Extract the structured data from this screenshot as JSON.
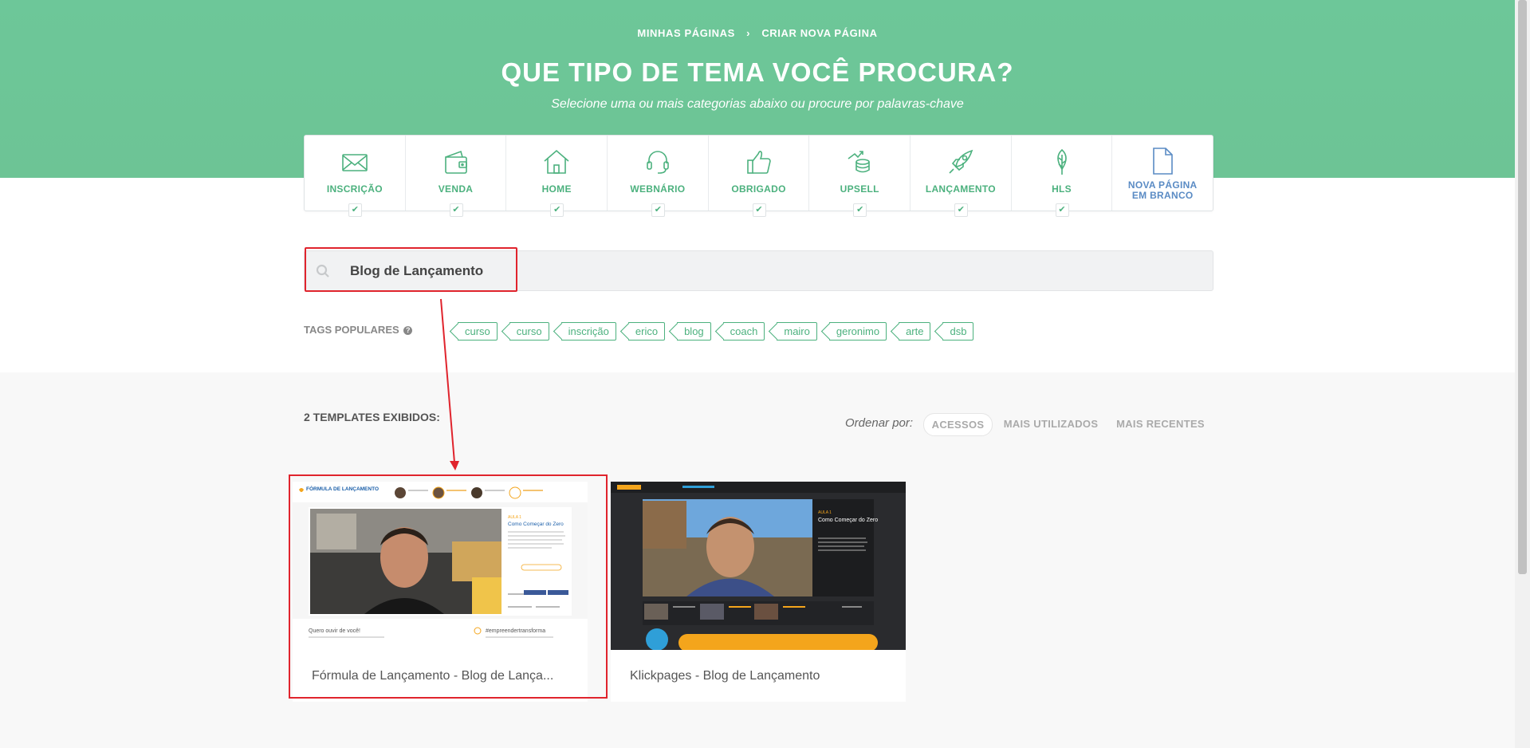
{
  "breadcrumb": {
    "parent": "MINHAS PÁGINAS",
    "separator": "›",
    "current": "CRIAR NOVA PÁGINA"
  },
  "hero": {
    "title": "QUE TIPO DE TEMA VOCÊ PROCURA?",
    "subtitle": "Selecione uma ou mais categorias abaixo ou procure por palavras-chave"
  },
  "categories": [
    {
      "label": "INSCRIÇÃO",
      "icon": "envelope-icon",
      "checked": true
    },
    {
      "label": "VENDA",
      "icon": "wallet-icon",
      "checked": true
    },
    {
      "label": "HOME",
      "icon": "house-icon",
      "checked": true
    },
    {
      "label": "WEBNÁRIO",
      "icon": "headset-icon",
      "checked": true
    },
    {
      "label": "OBRIGADO",
      "icon": "thumbs-up-icon",
      "checked": true
    },
    {
      "label": "UPSELL",
      "icon": "coins-icon",
      "checked": true
    },
    {
      "label": "LANÇAMENTO",
      "icon": "rocket-icon",
      "checked": true
    },
    {
      "label": "HLS",
      "icon": "leaf-icon",
      "checked": true
    }
  ],
  "blank_page": {
    "line1": "NOVA PÁGINA",
    "line2": "EM BRANCO",
    "icon": "document-icon"
  },
  "search": {
    "value": "Blog de Lançamento",
    "icon": "search-icon"
  },
  "tags": {
    "label": "TAGS POPULARES",
    "help": "?",
    "items": [
      "curso",
      "curso",
      "inscrição",
      "erico",
      "blog",
      "coach",
      "mairo",
      "geronimo",
      "arte",
      "dsb"
    ]
  },
  "results": {
    "count_label": "2 TEMPLATES EXIBIDOS:",
    "sort_label": "Ordenar por:",
    "sort_options": [
      "ACESSOS",
      "MAIS UTILIZADOS",
      "MAIS RECENTES"
    ],
    "active_sort": "ACESSOS"
  },
  "templates": [
    {
      "name": "Fórmula de Lançamento - Blog de Lança...",
      "preview": {
        "logo": "FÓRMULA DE LANÇAMENTO",
        "lesson": "AULA 1",
        "heading": "Como Começar do Zero",
        "comment": "Quero ouvir de você!",
        "hashtag": "#empreendertransforma"
      }
    },
    {
      "name": "Klickpages - Blog de Lançamento",
      "preview": {
        "lesson": "AULA 1",
        "heading": "Como Começar do Zero"
      }
    }
  ],
  "colors": {
    "brand_green": "#6dc799",
    "highlight_red": "#e0242d",
    "link_blue": "#5a8bc4"
  }
}
